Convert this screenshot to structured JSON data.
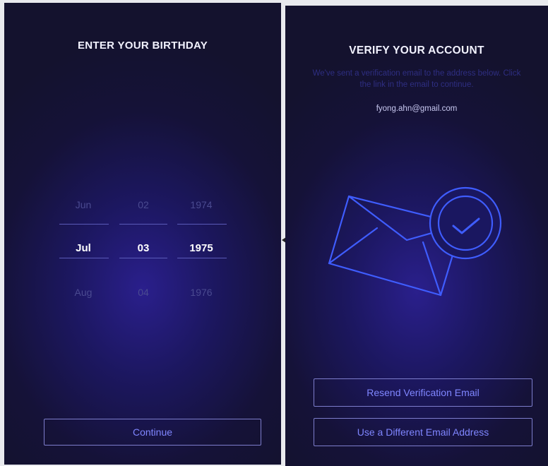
{
  "birthday": {
    "title": "ENTER YOUR BIRTHDAY",
    "picker": {
      "months": [
        "Jun",
        "Jul",
        "Aug"
      ],
      "days": [
        "02",
        "03",
        "04"
      ],
      "years": [
        "1974",
        "1975",
        "1976"
      ],
      "selected": {
        "month": "Jul",
        "day": "03",
        "year": "1975"
      }
    },
    "continue_label": "Continue"
  },
  "verify": {
    "title": "VERIFY YOUR ACCOUNT",
    "description": "We've sent a verification email to the address below. Click the link in the email to continue.",
    "email": "fyong.ahn@gmail.com",
    "illustration_icon": "envelope-checkmark-icon",
    "resend_label": "Resend Verification Email",
    "different_email_label": "Use a Different Email Address"
  },
  "colors": {
    "background": "#151238",
    "glow": "#2a1f8c",
    "accent": "#7f86ff",
    "line_art": "#3f5dff"
  }
}
